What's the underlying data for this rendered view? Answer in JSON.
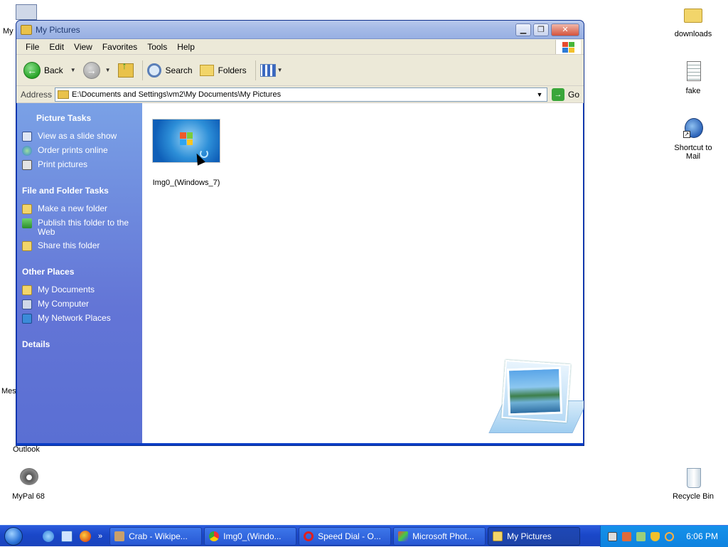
{
  "desktop": {
    "icons": [
      {
        "name": "downloads"
      },
      {
        "name": "fake"
      },
      {
        "name": "Shortcut to Mail"
      },
      {
        "name": "Recycle Bin"
      },
      {
        "name": "MyPal 68"
      }
    ],
    "partial_labels": [
      "My",
      "Mes",
      "Outlook"
    ]
  },
  "window": {
    "title": "My Pictures",
    "menu": [
      "File",
      "Edit",
      "View",
      "Favorites",
      "Tools",
      "Help"
    ],
    "toolbar": {
      "back": "Back",
      "search": "Search",
      "folders": "Folders"
    },
    "address": {
      "label": "Address",
      "path": "E:\\Documents and Settings\\vm2\\My Documents\\My Pictures",
      "go": "Go"
    },
    "tasks": {
      "picture_tasks": {
        "heading": "Picture Tasks",
        "items": [
          "View as a slide show",
          "Order prints online",
          "Print pictures"
        ]
      },
      "file_folder_tasks": {
        "heading": "File and Folder Tasks",
        "items": [
          "Make a new folder",
          "Publish this folder to the Web",
          "Share this folder"
        ]
      },
      "other_places": {
        "heading": "Other Places",
        "items": [
          "My Documents",
          "My Computer",
          "My Network Places"
        ]
      },
      "details": {
        "heading": "Details"
      }
    },
    "files": [
      {
        "name": "Img0_(Windows_7)"
      }
    ]
  },
  "taskbar": {
    "tasks": [
      "Crab - Wikipe...",
      "Img0_(Windo...",
      "Speed Dial - O...",
      "Microsoft Phot...",
      "My Pictures"
    ],
    "clock": "6:06 PM"
  },
  "colors": {
    "taskpane": "#6375d6",
    "taskbar": "#1a47c8",
    "window_border": "#0a3ec7"
  }
}
